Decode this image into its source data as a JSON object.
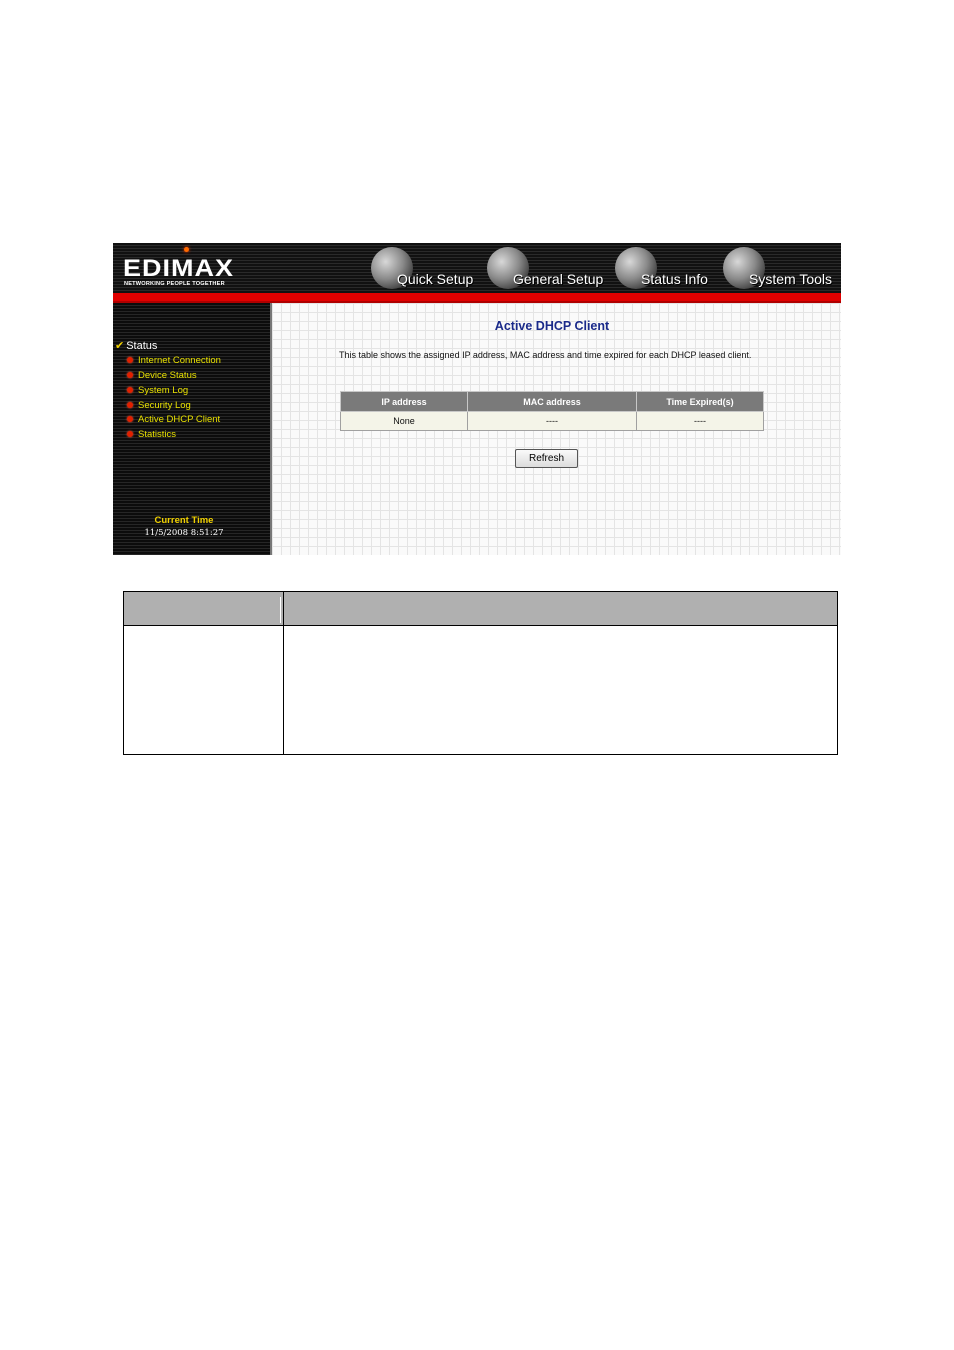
{
  "brand": {
    "name": "EDIMAX",
    "tagline": "NETWORKING PEOPLE TOGETHER"
  },
  "nav": [
    {
      "label": "Quick Setup"
    },
    {
      "label": "General Setup"
    },
    {
      "label": "Status Info"
    },
    {
      "label": "System Tools"
    }
  ],
  "sidebar": {
    "section": "Status",
    "items": [
      {
        "label": "Internet Connection"
      },
      {
        "label": "Device Status"
      },
      {
        "label": "System Log"
      },
      {
        "label": "Security Log"
      },
      {
        "label": "Active DHCP Client"
      },
      {
        "label": "Statistics"
      }
    ],
    "current_time_label": "Current Time",
    "current_time_value": "11/5/2008 8:51:27"
  },
  "main": {
    "title": "Active DHCP Client",
    "description": "This table shows the assigned IP address, MAC address and time expired for each DHCP leased client.",
    "table": {
      "headers": [
        "IP address",
        "MAC address",
        "Time Expired(s)"
      ],
      "rows": [
        [
          "None",
          "----",
          "----"
        ]
      ]
    },
    "refresh_label": "Refresh"
  },
  "colors": {
    "accent_red": "#e00000",
    "menu_text": "#e8e000",
    "title_blue": "#1a2a8a"
  }
}
